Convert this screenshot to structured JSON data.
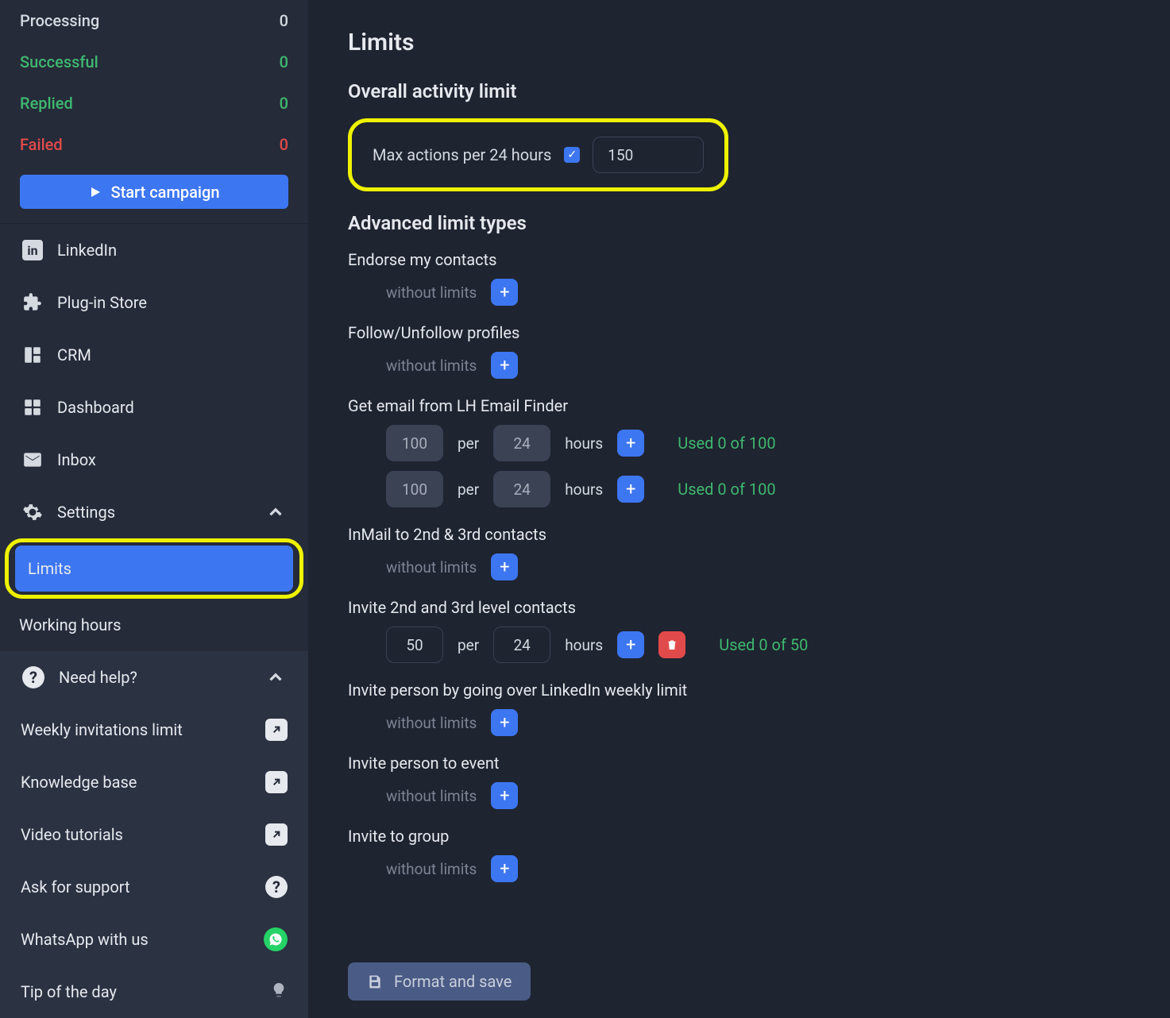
{
  "sidebar": {
    "stats": [
      {
        "label": "Processing",
        "value": "0",
        "cls": ""
      },
      {
        "label": "Successful",
        "value": "0",
        "cls": "stat-green"
      },
      {
        "label": "Replied",
        "value": "0",
        "cls": "stat-green"
      },
      {
        "label": "Failed",
        "value": "0",
        "cls": "stat-red"
      }
    ],
    "start": "Start campaign",
    "nav": {
      "linkedin": "LinkedIn",
      "plugin": "Plug-in Store",
      "crm": "CRM",
      "dashboard": "Dashboard",
      "inbox": "Inbox",
      "settings": "Settings"
    },
    "subs": {
      "limits": "Limits",
      "working": "Working hours"
    },
    "help": {
      "title": "Need help?",
      "weekly": "Weekly invitations limit",
      "kb": "Knowledge base",
      "video": "Video tutorials",
      "ask": "Ask for support",
      "wa": "WhatsApp with us",
      "tip": "Tip of the day"
    }
  },
  "main": {
    "title": "Limits",
    "overall": {
      "heading": "Overall activity limit",
      "label": "Max actions per 24 hours",
      "value": "150"
    },
    "advanced_heading": "Advanced limit types",
    "without": "without limits",
    "per": "per",
    "hours": "hours",
    "limits": {
      "endorse": "Endorse my contacts",
      "follow": "Follow/Unfollow profiles",
      "email": "Get email from LH Email Finder",
      "inmail": "InMail to 2nd & 3rd contacts",
      "invite23": "Invite 2nd and 3rd level contacts",
      "inviteWeekly": "Invite person by going over LinkedIn weekly limit",
      "inviteEvent": "Invite person to event",
      "inviteGroup": "Invite to group"
    },
    "email_rows": [
      {
        "count": "100",
        "per": "24",
        "used": "Used 0 of 100"
      },
      {
        "count": "100",
        "per": "24",
        "used": "Used 0 of 100"
      }
    ],
    "invite23_row": {
      "count": "50",
      "per": "24",
      "used": "Used 0 of 50"
    },
    "save": "Format and save"
  }
}
